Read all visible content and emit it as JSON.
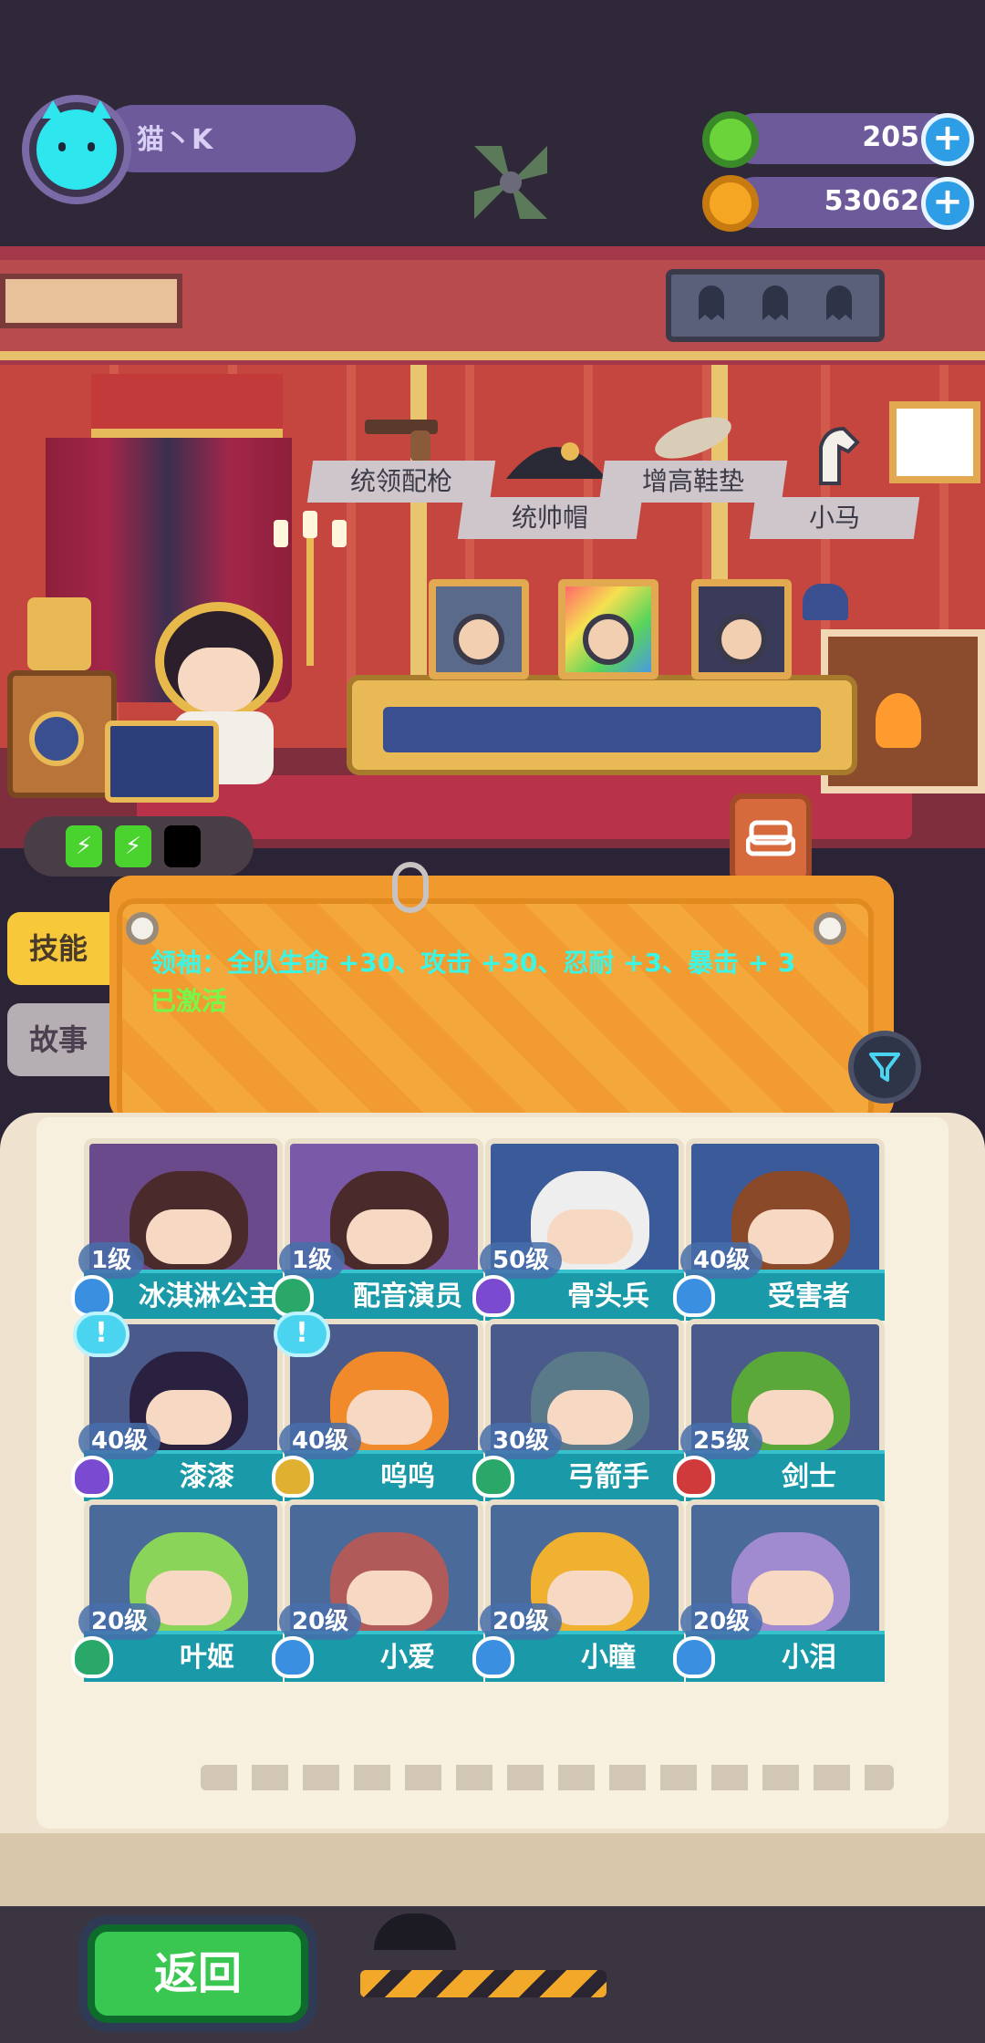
{
  "player": {
    "name": "猫丶K"
  },
  "resources": [
    {
      "id": "gems",
      "value": "205",
      "icon": "green-donut-icon",
      "color": "#6ad43a"
    },
    {
      "id": "coins",
      "value": "53062",
      "icon": "planet-coin-icon",
      "color": "#f5a623"
    }
  ],
  "equipment": [
    {
      "label": "统领配枪",
      "icon": "pistol-icon"
    },
    {
      "label": "统帅帽",
      "icon": "bicorne-hat-icon"
    },
    {
      "label": "增高鞋垫",
      "icon": "insole-icon"
    },
    {
      "label": "小马",
      "icon": "pony-icon"
    }
  ],
  "energy": {
    "filled": 2,
    "total": 3,
    "symbol": "⚡"
  },
  "tabs": {
    "skill": "技能",
    "story": "故事"
  },
  "skill": {
    "text": "领袖：全队生命 +30、攻击 +30、忍耐 +3、暴击 + 3",
    "status": "已激活"
  },
  "characters": [
    {
      "level": "1级",
      "name": "冰淇淋公主",
      "class_color": "#3a8fe0",
      "bg": "#6a4a8a",
      "hair": "#4a2a2a",
      "alert": false
    },
    {
      "level": "1级",
      "name": "配音演员",
      "class_color": "#2aa86a",
      "bg": "#7a5aa8",
      "hair": "#4a2a2a",
      "alert": false
    },
    {
      "level": "50级",
      "name": "骨头兵",
      "class_color": "#7a4ad0",
      "bg": "#3a5a9a",
      "hair": "#eeeeee",
      "alert": false
    },
    {
      "level": "40级",
      "name": "受害者",
      "class_color": "#3a8fe0",
      "bg": "#3a5a9a",
      "hair": "#8a4a2a",
      "alert": false
    },
    {
      "level": "40级",
      "name": "漆漆",
      "class_color": "#7a4ad0",
      "bg": "#4a5a8a",
      "hair": "#2a2040",
      "alert": true
    },
    {
      "level": "40级",
      "name": "呜呜",
      "class_color": "#e0b030",
      "bg": "#4a5a8a",
      "hair": "#f08a2a",
      "alert": true
    },
    {
      "level": "30级",
      "name": "弓箭手",
      "class_color": "#2aa86a",
      "bg": "#4a5a8a",
      "hair": "#5a7a8a",
      "alert": false
    },
    {
      "level": "25级",
      "name": "剑士",
      "class_color": "#d03a3a",
      "bg": "#4a5a8a",
      "hair": "#5aa83a",
      "alert": false
    },
    {
      "level": "20级",
      "name": "叶姬",
      "class_color": "#2aa86a",
      "bg": "#4a6a9a",
      "hair": "#8ad45a",
      "alert": false
    },
    {
      "level": "20级",
      "name": "小爱",
      "class_color": "#3a8fe0",
      "bg": "#4a6a9a",
      "hair": "#b05a5a",
      "alert": false
    },
    {
      "level": "20级",
      "name": "小瞳",
      "class_color": "#3a8fe0",
      "bg": "#4a6a9a",
      "hair": "#f0b030",
      "alert": false
    },
    {
      "level": "20级",
      "name": "小泪",
      "class_color": "#3a8fe0",
      "bg": "#4a6a9a",
      "hair": "#a08ad0",
      "alert": false
    }
  ],
  "back_button": "返回"
}
